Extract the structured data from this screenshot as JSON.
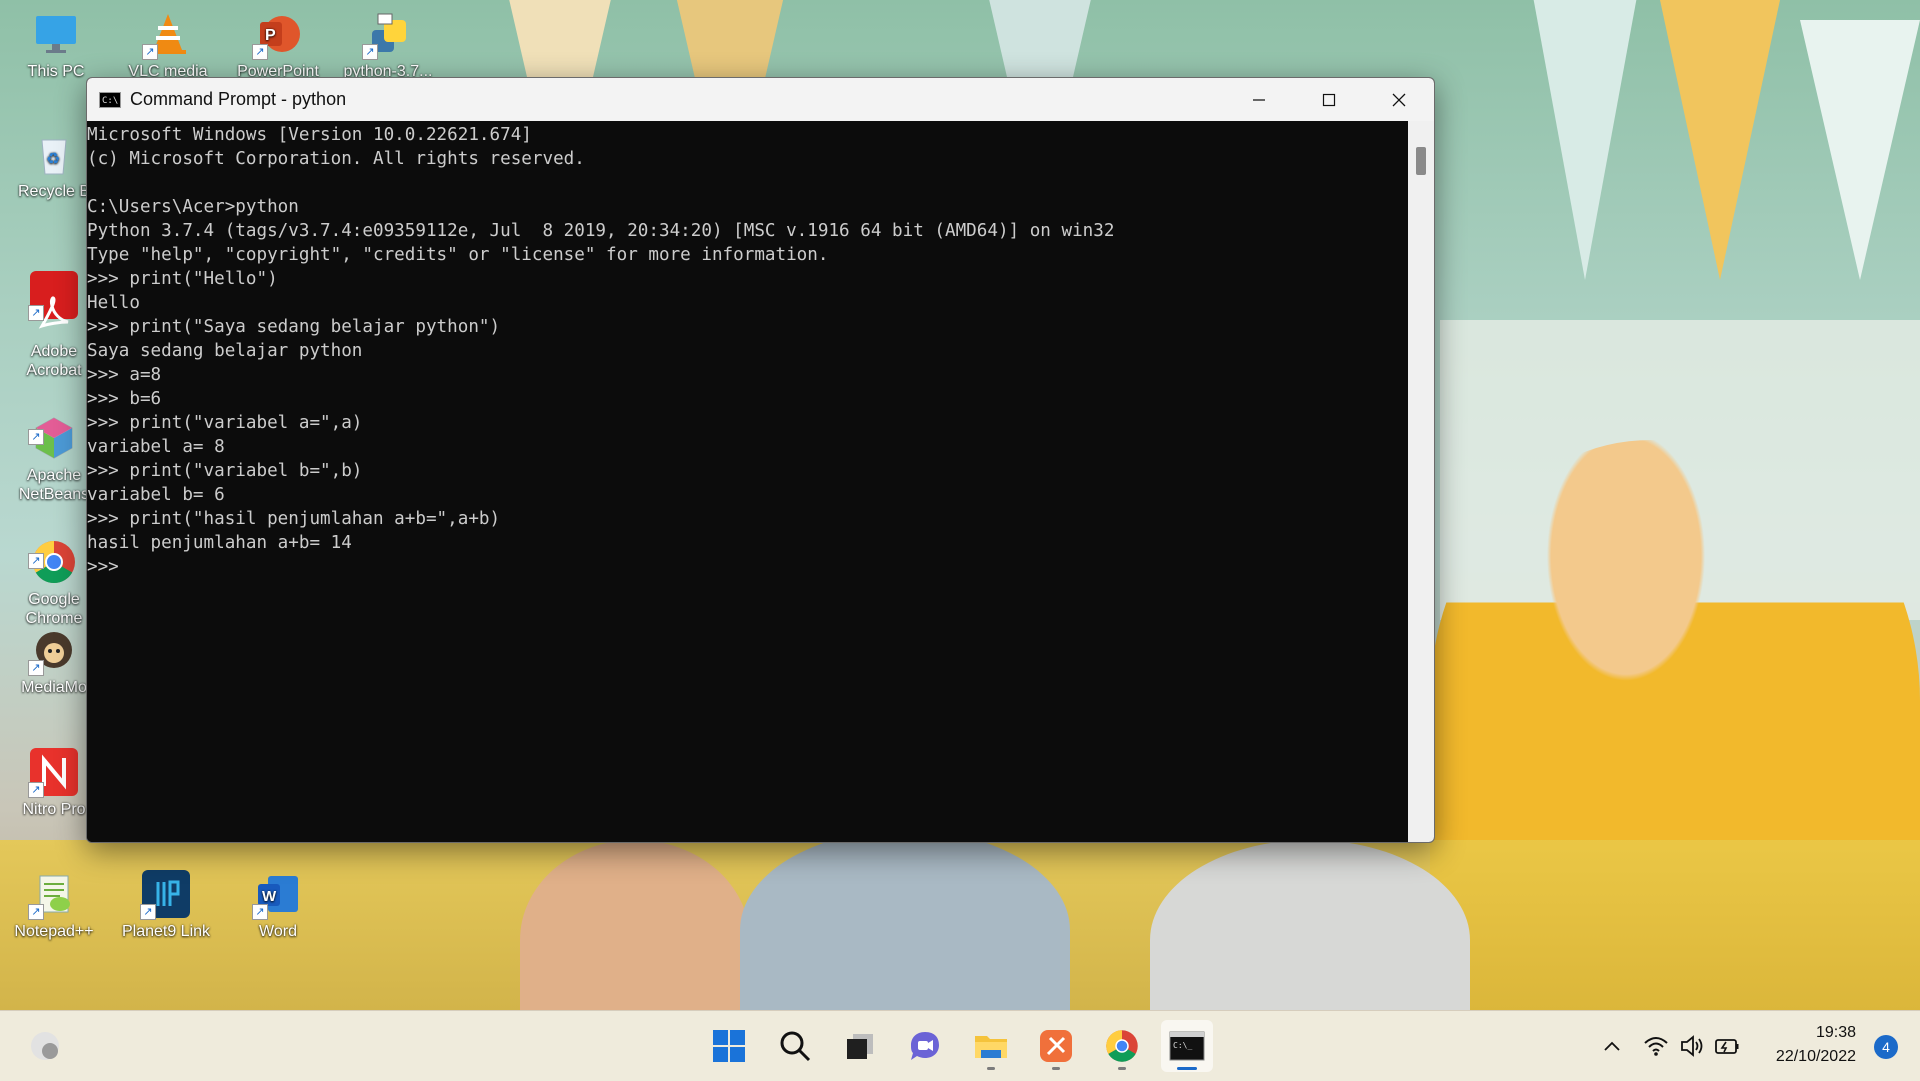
{
  "desktop": {
    "icons": [
      {
        "label": "This PC"
      },
      {
        "label": "VLC media"
      },
      {
        "label": "PowerPoint"
      },
      {
        "label": "python-3.7..."
      },
      {
        "label": "Recycle B"
      },
      {
        "label": "Adobe\nAcrobat"
      },
      {
        "label": "Apache\nNetBeans"
      },
      {
        "label": "Google\nChrome"
      },
      {
        "label": "MediaMo"
      },
      {
        "label": "Nitro Pro"
      },
      {
        "label": "Notepad++"
      },
      {
        "label": "Planet9 Link"
      },
      {
        "label": "Word"
      }
    ]
  },
  "window": {
    "title": "Command Prompt - python",
    "icon_name": "console-app-icon",
    "controls": [
      "minimize-icon",
      "maximize-icon",
      "close-icon"
    ]
  },
  "console": {
    "lines": [
      "Microsoft Windows [Version 10.0.22621.674]",
      "(c) Microsoft Corporation. All rights reserved.",
      "",
      "C:\\Users\\Acer>python",
      "Python 3.7.4 (tags/v3.7.4:e09359112e, Jul  8 2019, 20:34:20) [MSC v.1916 64 bit (AMD64)] on win32",
      "Type \"help\", \"copyright\", \"credits\" or \"license\" for more information.",
      ">>> print(\"Hello\")",
      "Hello",
      ">>> print(\"Saya sedang belajar python\")",
      "Saya sedang belajar python",
      ">>> a=8",
      ">>> b=6",
      ">>> print(\"variabel a=\",a)",
      "variabel a= 8",
      ">>> print(\"variabel b=\",b)",
      "variabel b= 6",
      ">>> print(\"hasil penjumlahan a+b=\",a+b)",
      "hasil penjumlahan a+b= 14",
      ">>>"
    ]
  },
  "taskbar": {
    "apps": [
      {
        "name": "start-button",
        "icon": "windows-logo-icon"
      },
      {
        "name": "search-button",
        "icon": "search-icon"
      },
      {
        "name": "task-view-button",
        "icon": "task-view-icon"
      },
      {
        "name": "chat-button",
        "icon": "chat-icon"
      },
      {
        "name": "file-explorer-button",
        "icon": "folder-icon"
      },
      {
        "name": "snip-app-button",
        "icon": "snip-icon"
      },
      {
        "name": "chrome-button",
        "icon": "chrome-icon"
      },
      {
        "name": "terminal-button",
        "icon": "terminal-icon"
      }
    ],
    "time": "19:38",
    "date": "22/10/2022",
    "notification_count": "4",
    "colors": {
      "accent": "#1b6ac9"
    }
  }
}
